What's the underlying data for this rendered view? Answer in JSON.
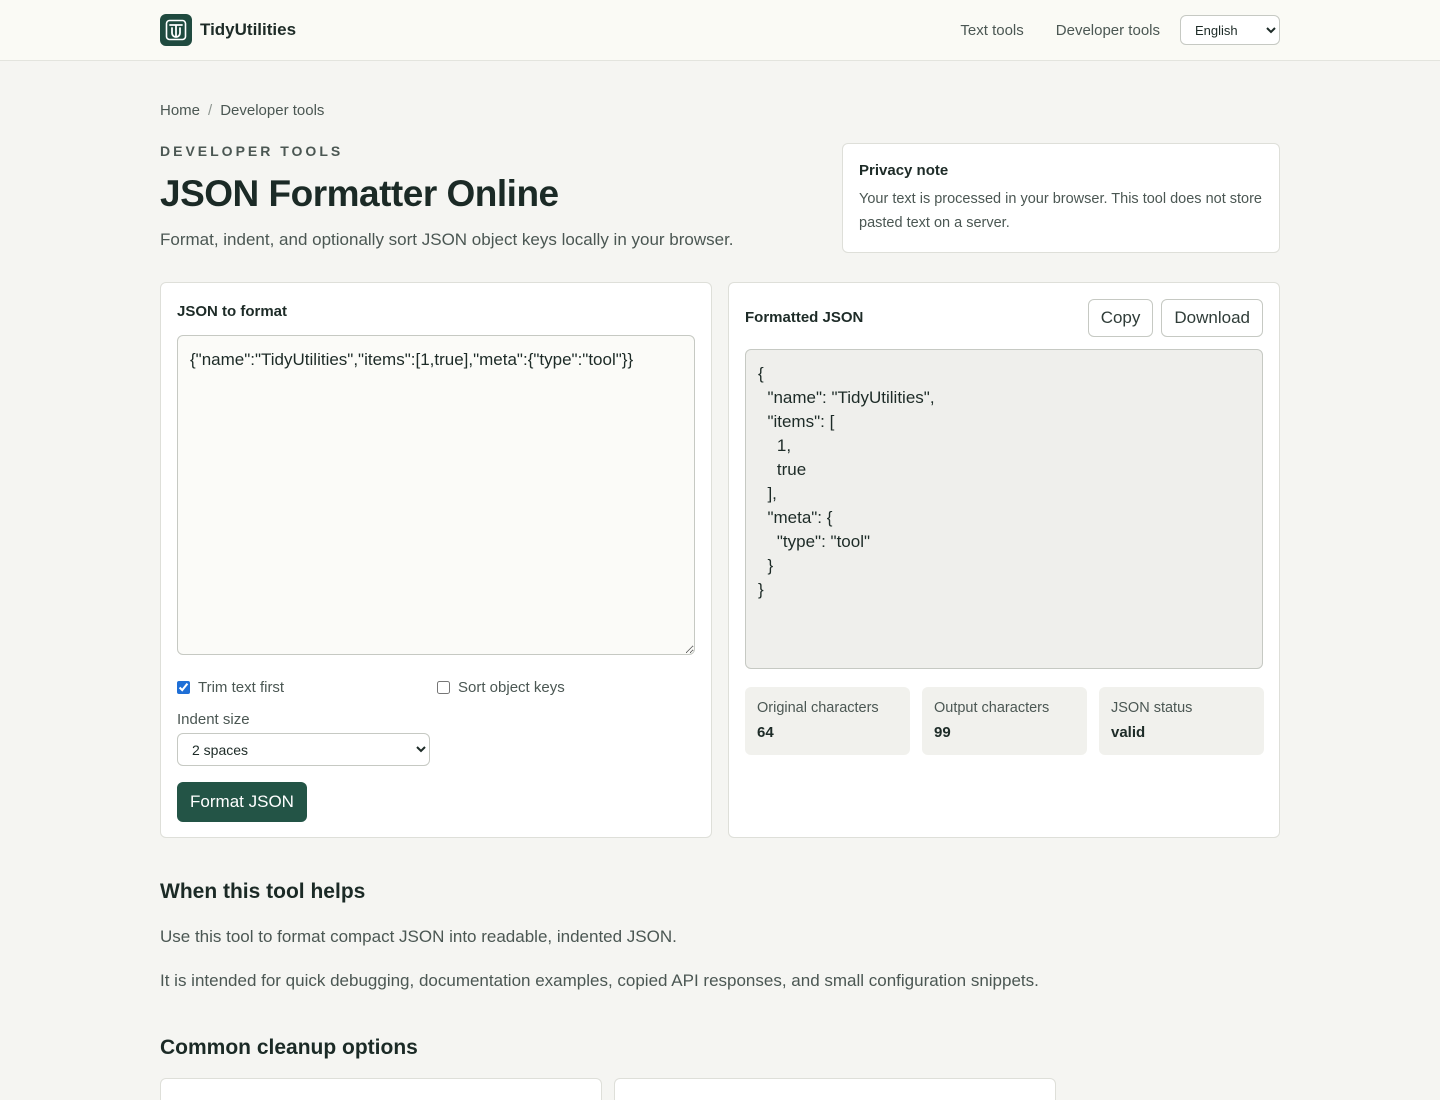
{
  "header": {
    "brand": "TidyUtilities",
    "nav": [
      "Text tools",
      "Developer tools"
    ],
    "language": "English",
    "colors": {
      "brand": "#1f4a3f"
    }
  },
  "breadcrumb": {
    "home": "Home",
    "separator": "/",
    "current": "Developer tools"
  },
  "hero": {
    "eyebrow": "DEVELOPER TOOLS",
    "title": "JSON Formatter Online",
    "lead": "Format, indent, and optionally sort JSON object keys locally in your browser."
  },
  "privacy": {
    "title": "Privacy note",
    "text": "Your text is processed in your browser. This tool does not store pasted text on a server."
  },
  "input_panel": {
    "label": "JSON to format",
    "value": "{\"name\":\"TidyUtilities\",\"items\":[1,true],\"meta\":{\"type\":\"tool\"}}",
    "trim_label": "Trim text first",
    "trim_checked": true,
    "sort_label": "Sort object keys",
    "sort_checked": false,
    "indent_label": "Indent size",
    "indent_value": "2 spaces",
    "format_button": "Format JSON",
    "colors": {
      "primary": "#235446"
    }
  },
  "output_panel": {
    "label": "Formatted JSON",
    "copy_button": "Copy",
    "download_button": "Download",
    "value": "{\n  \"name\": \"TidyUtilities\",\n  \"items\": [\n    1,\n    true\n  ],\n  \"meta\": {\n    \"type\": \"tool\"\n  }\n}",
    "stats": [
      {
        "label": "Original characters",
        "value": "64"
      },
      {
        "label": "Output characters",
        "value": "99"
      },
      {
        "label": "JSON status",
        "value": "valid"
      }
    ]
  },
  "content": {
    "helps_heading": "When this tool helps",
    "helps_p1": "Use this tool to format compact JSON into readable, indented JSON.",
    "helps_p2": "It is intended for quick debugging, documentation examples, copied API responses, and small configuration snippets.",
    "options_heading": "Common cleanup options"
  }
}
